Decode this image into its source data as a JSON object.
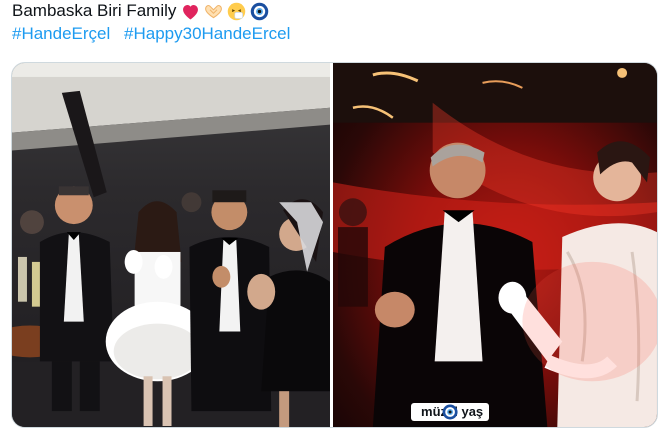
{
  "tweet": {
    "text": "Bambaska Biri Family",
    "emojis": [
      "red-heart-emoji",
      "heart-hands-emoji",
      "sneezing-face-emoji",
      "nazar-amulet-emoji"
    ],
    "hashtags": [
      "#HandeErçel",
      "#Happy30HandeErcel"
    ]
  },
  "media": {
    "left_photo": {
      "alt": "Party photo of a group dancing"
    },
    "right_photo": {
      "alt": "Man in tuxedo talking with a woman in white",
      "sticker_text": "müzel yaş"
    }
  },
  "colors": {
    "link": "#1d9bf0",
    "text": "#0f1419",
    "heart": "#e0245e",
    "red_light": "#b31a13"
  }
}
